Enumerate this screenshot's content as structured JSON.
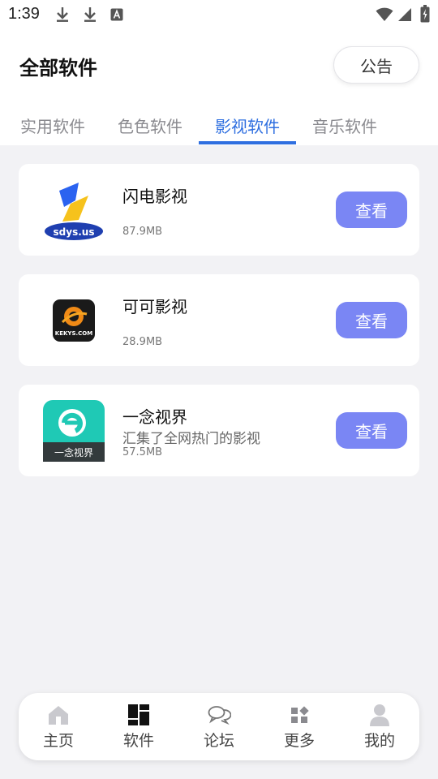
{
  "status_bar": {
    "time": "1:39",
    "icons": [
      "download-icon",
      "download-icon",
      "keyboard-a-icon",
      "wifi-icon",
      "signal-icon",
      "battery-charging-icon"
    ]
  },
  "header": {
    "title": "全部软件",
    "notice_label": "公告"
  },
  "tabs": [
    {
      "label": "实用软件",
      "active": false
    },
    {
      "label": "色色软件",
      "active": false
    },
    {
      "label": "影视软件",
      "active": true
    },
    {
      "label": "音乐软件",
      "active": false
    }
  ],
  "apps": [
    {
      "name": "闪电影视",
      "description": "",
      "size": "87.9MB",
      "button": "查看",
      "icon": "sdys-logo-icon",
      "icon_text": "sdys.us"
    },
    {
      "name": "可可影视",
      "description": "",
      "size": "28.9MB",
      "button": "查看",
      "icon": "kekys-logo-icon",
      "icon_text": "KEKYS.COM"
    },
    {
      "name": "一念视界",
      "description": "汇集了全网热门的影视",
      "size": "57.5MB",
      "button": "查看",
      "icon": "yinian-logo-icon",
      "icon_text": "一念视界"
    }
  ],
  "bottom_nav": [
    {
      "label": "主页",
      "icon": "home-icon"
    },
    {
      "label": "软件",
      "icon": "apps-grid-icon"
    },
    {
      "label": "论坛",
      "icon": "chat-bubbles-icon"
    },
    {
      "label": "更多",
      "icon": "more-grid-icon"
    },
    {
      "label": "我的",
      "icon": "user-icon"
    }
  ],
  "colors": {
    "accent": "#2f6fe0",
    "button": "#7a86f4",
    "background": "#f2f2f5"
  }
}
